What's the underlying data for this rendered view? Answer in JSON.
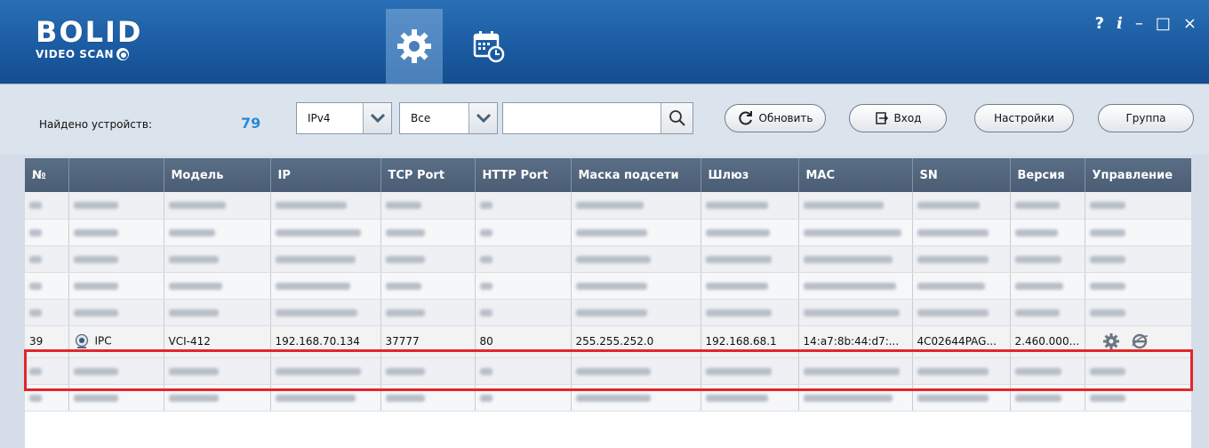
{
  "app": {
    "logo_text": "BOLID",
    "logo_subtext": "VIDEO SCAN"
  },
  "nav": {
    "settings_tab_icon": "gear-icon",
    "schedule_tab_icon": "calendar-clock-icon"
  },
  "window_controls": {
    "help": "?",
    "info": "i",
    "minimize": "–",
    "maximize": "□",
    "close": "×"
  },
  "toolbar": {
    "found_label": "Найдено устройств:",
    "found_count": "79",
    "ip_version": "IPv4",
    "filter": "Все",
    "search_value": "",
    "refresh_label": "Обновить",
    "login_label": "Вход",
    "settings_label": "Настройки",
    "group_label": "Группа"
  },
  "table": {
    "columns": [
      "№",
      "",
      "Модель",
      "IP",
      "TCP Port",
      "HTTP Port",
      "Маска подсети",
      "Шлюз",
      "MAC",
      "SN",
      "Версия",
      "Управление"
    ],
    "selected_row": {
      "num": "39",
      "type": "IPC",
      "model": "VCI-412",
      "ip": "192.168.70.134",
      "tcp_port": "37777",
      "http_port": "80",
      "mask": "255.255.252.0",
      "gateway": "192.168.68.1",
      "mac": "14:a7:8b:44:d7:...",
      "sn": "4C02644PAG...",
      "version": "2.460.000..."
    }
  },
  "colors": {
    "titlebar": "#1a5aa0",
    "header": "#4a5d74",
    "accent_count": "#2a8ad8",
    "selection_outline": "#e3262b"
  }
}
